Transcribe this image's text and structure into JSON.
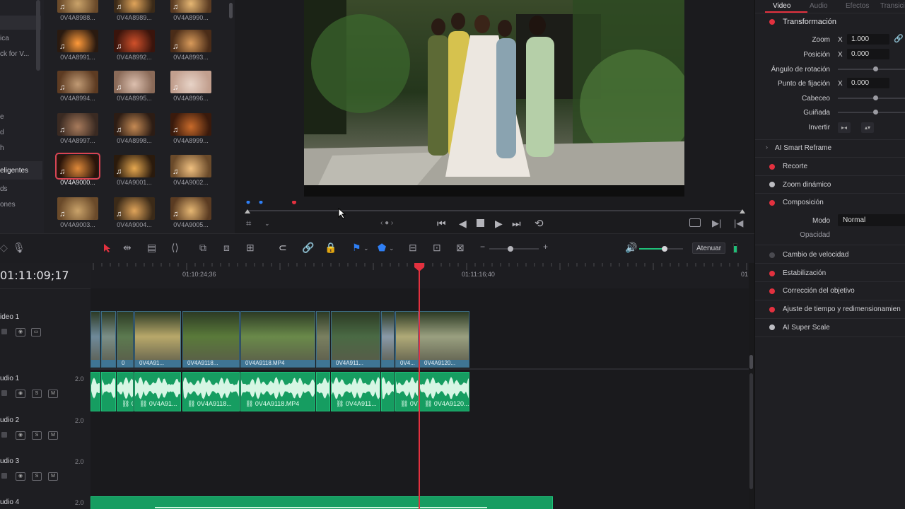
{
  "sidebar": {
    "items": [
      {
        "label": "ica"
      },
      {
        "label": "ck for V..."
      },
      {
        "label": "e"
      },
      {
        "label": "d"
      },
      {
        "label": "h"
      },
      {
        "label": "eligentes"
      },
      {
        "label": "ds"
      },
      {
        "label": "ones"
      }
    ]
  },
  "media_pool": {
    "thumbnails": [
      {
        "label": "0V4A8988..."
      },
      {
        "label": "0V4A8989..."
      },
      {
        "label": "0V4A8990..."
      },
      {
        "label": "0V4A8991..."
      },
      {
        "label": "0V4A8992..."
      },
      {
        "label": "0V4A8993..."
      },
      {
        "label": "0V4A8994..."
      },
      {
        "label": "0V4A8995..."
      },
      {
        "label": "0V4A8996..."
      },
      {
        "label": "0V4A8997..."
      },
      {
        "label": "0V4A8998..."
      },
      {
        "label": "0V4A8999..."
      },
      {
        "label": "0V4A9000...",
        "selected": true
      },
      {
        "label": "0V4A9001..."
      },
      {
        "label": "0V4A9002..."
      },
      {
        "label": "0V4A9003..."
      },
      {
        "label": "0V4A9004..."
      },
      {
        "label": "0V4A9005..."
      }
    ],
    "note_glyph": "♫"
  },
  "inspector": {
    "tabs": [
      {
        "label": "Video",
        "active": true
      },
      {
        "label": "Audio"
      },
      {
        "label": "Efectos"
      },
      {
        "label": "Transicio"
      }
    ],
    "transform": {
      "title": "Transformación",
      "zoom_label": "Zoom",
      "zoom_axis": "X",
      "zoom_value": "1.000",
      "position_label": "Posición",
      "position_axis": "X",
      "position_value": "0.000",
      "rotation_label": "Ángulo de rotación",
      "anchor_label": "Punto de fijación",
      "anchor_axis": "X",
      "anchor_value": "0.000",
      "pitch_label": "Cabeceo",
      "yaw_label": "Guiñada",
      "flip_label": "Invertir"
    },
    "smart_reframe": "AI Smart Reframe",
    "crop": "Recorte",
    "dynamic_zoom": "Zoom dinámico",
    "composite": {
      "title": "Composición",
      "mode_label": "Modo",
      "mode_value": "Normal",
      "opacity_label": "Opacidad"
    },
    "speed_change": "Cambio de velocidad",
    "stabilization": "Estabilización",
    "lens_correction": "Corrección del objetivo",
    "retime": "Ajuste de tiempo y redimensionamien",
    "super_scale": "AI Super Scale"
  },
  "toolbar": {
    "attenuate_label": "Atenuar"
  },
  "timeline": {
    "timecode": "01:11:09;17",
    "ruler_marks": [
      "01:10:24;36",
      "01:11:16;40",
      "01"
    ],
    "tracks": [
      {
        "name": "ideo 1",
        "type": "video"
      },
      {
        "name": "udio 1",
        "type": "audio",
        "level": "2.0"
      },
      {
        "name": "udio 2",
        "type": "audio",
        "level": "2.0"
      },
      {
        "name": "udio 3",
        "type": "audio",
        "level": "2.0"
      },
      {
        "name": "udio 4",
        "type": "audio",
        "level": "2.0"
      }
    ],
    "solo_label": "S",
    "mute_label": "M",
    "video_clips": [
      {
        "label": ""
      },
      {
        "label": ""
      },
      {
        "label": "0"
      },
      {
        "label": "0V4A91..."
      },
      {
        "label": "0V4A9118..."
      },
      {
        "label": "0V4A9118.MP4"
      },
      {
        "label": ""
      },
      {
        "label": "0V4A911..."
      },
      {
        "label": ""
      },
      {
        "label": "0V4..."
      },
      {
        "label": "0V4A9120..."
      }
    ],
    "audio_clips": [
      {
        "label": ""
      },
      {
        "label": ""
      },
      {
        "label": "0..."
      },
      {
        "label": "0V4A91..."
      },
      {
        "label": "0V4A9118..."
      },
      {
        "label": "0V4A9118.MP4"
      },
      {
        "label": ""
      },
      {
        "label": "0V4A911..."
      },
      {
        "label": ""
      },
      {
        "label": "0V4..."
      },
      {
        "label": "0V4A9120..."
      }
    ]
  },
  "colors": {
    "accent_red": "#e3313f",
    "audio_clip": "#169d61",
    "video_clip": "#3f7594",
    "flag_blue": "#2f7ff5"
  }
}
